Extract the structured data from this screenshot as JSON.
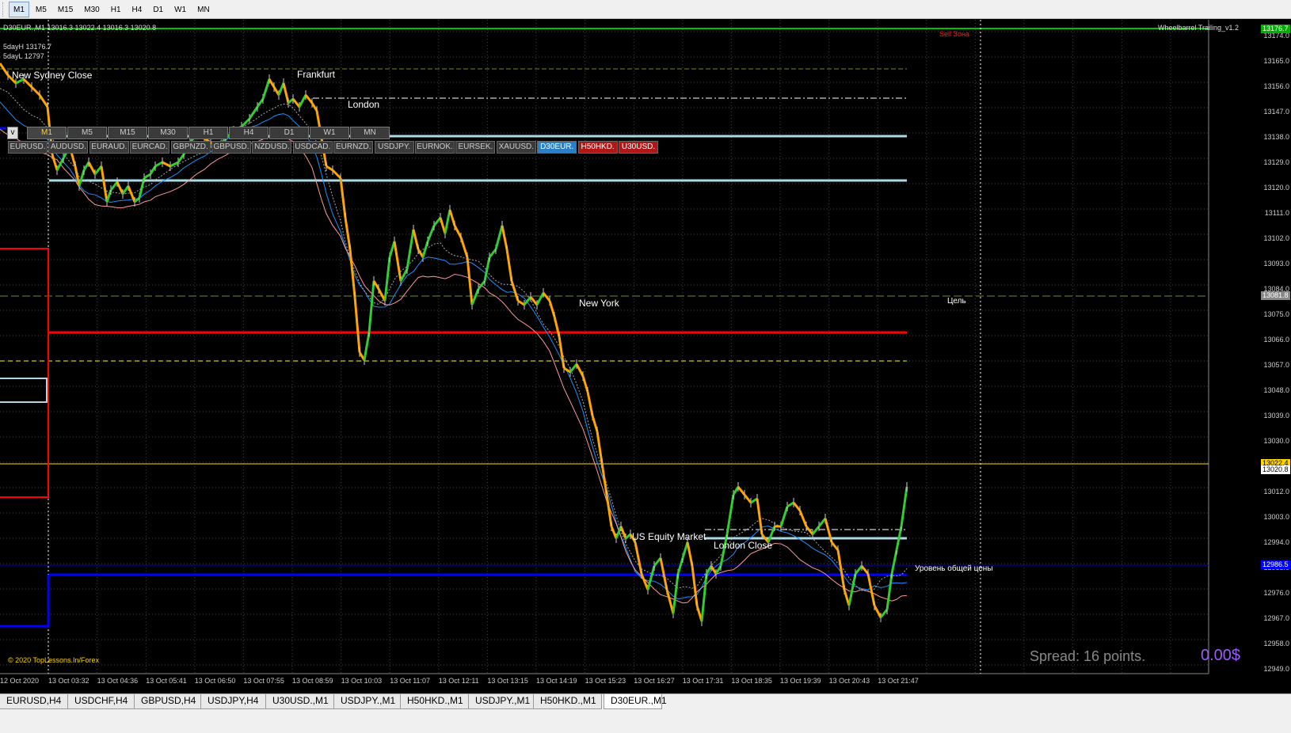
{
  "toolbar": {
    "timeframes": [
      "M1",
      "M5",
      "M15",
      "M30",
      "H1",
      "H4",
      "D1",
      "W1",
      "MN"
    ],
    "active": "M1"
  },
  "chart": {
    "header": "D30EUR.,M1  13016.3 13022.4 13016.3 13020.8",
    "indicator_name": "Wheelbarrel Trailing_v1.2",
    "sell_zone_label": "Sell Зона",
    "day_high": "5dayH 13176.7",
    "day_low": "5dayL 12797",
    "session_labels": {
      "ny_sydney_close": "New Sydney Close",
      "frankfurt": "Frankfurt",
      "london": "London",
      "new_york": "New York",
      "us_equity": "US Equity Market",
      "london_close": "London Close"
    },
    "target_label": "Цель",
    "level_label": "Уровень общей цены",
    "copyright": "© 2020 TopLessons.In/Forex",
    "spread": "Spread: 16 points.",
    "profit": "0.00$",
    "colors": {
      "bull_candle": "#32cd32",
      "bear_candle": "#ffa500",
      "grid": "#444444",
      "red_level": "#ff0000",
      "blue_level": "#0000ff",
      "light_blue_level": "#add8e6",
      "yellow_dash": "#ffff00",
      "ma_blue": "#1e90ff",
      "ma_pink": "#ff9999"
    },
    "price_axis": [
      "13174.0",
      "13165.0",
      "13156.0",
      "13147.0",
      "13138.0",
      "13129.0",
      "13120.0",
      "13111.0",
      "13102.0",
      "13093.0",
      "13084.0",
      "13075.0",
      "13066.0",
      "13057.0",
      "13048.0",
      "13039.0",
      "13030.0",
      "13021.0",
      "13012.0",
      "13003.0",
      "12994.0",
      "12985.0",
      "12976.0",
      "12967.0",
      "12958.0",
      "12949.0"
    ],
    "price_tags": {
      "top": "13176.7",
      "target": "13081.8",
      "current_hi": "13022.4",
      "current": "13020.8",
      "level": "12986.5"
    },
    "time_axis": [
      "12 Oct 2020",
      "13 Oct 03:32",
      "13 Oct 04:36",
      "13 Oct 05:41",
      "13 Oct 06:50",
      "13 Oct 07:55",
      "13 Oct 08:59",
      "13 Oct 10:03",
      "13 Oct 11:07",
      "13 Oct 12:11",
      "13 Oct 13:15",
      "13 Oct 14:19",
      "13 Oct 15:23",
      "13 Oct 16:27",
      "13 Oct 17:31",
      "13 Oct 18:35",
      "13 Oct 19:39",
      "13 Oct 20:43",
      "13 Oct 21:47"
    ]
  },
  "panel": {
    "toggle": "v",
    "timeframes": [
      "M1",
      "M5",
      "M15",
      "M30",
      "H1",
      "H4",
      "D1",
      "W1",
      "MN"
    ],
    "symbols": [
      {
        "label": "EURUSD.",
        "style": "normal"
      },
      {
        "label": "AUDUSD.",
        "style": "normal"
      },
      {
        "label": "EURAUD.",
        "style": "normal"
      },
      {
        "label": "EURCAD.",
        "style": "normal"
      },
      {
        "label": "GBPNZD.",
        "style": "normal"
      },
      {
        "label": "GBPUSD.",
        "style": "normal"
      },
      {
        "label": "NZDUSD.",
        "style": "normal"
      },
      {
        "label": "USDCAD.",
        "style": "normal"
      },
      {
        "label": "EURNZD.",
        "style": "normal"
      },
      {
        "label": "USDJPY.",
        "style": "normal"
      },
      {
        "label": "EURNOK.",
        "style": "normal"
      },
      {
        "label": "EURSEK.",
        "style": "normal"
      },
      {
        "label": "XAUUSD.",
        "style": "normal"
      },
      {
        "label": "D30EUR.",
        "style": "blue"
      },
      {
        "label": "H50HKD.",
        "style": "red"
      },
      {
        "label": "U30USD.",
        "style": "red"
      }
    ]
  },
  "tabs": {
    "items": [
      "EURUSD,H4",
      "USDCHF,H4",
      "GBPUSD,H4",
      "USDJPY,H4",
      "U30USD.,M1",
      "USDJPY.,M1",
      "H50HKD.,M1",
      "USDJPY.,M1",
      "H50HKD.,M1",
      "D30EUR.,M1"
    ],
    "active_index": 9
  }
}
